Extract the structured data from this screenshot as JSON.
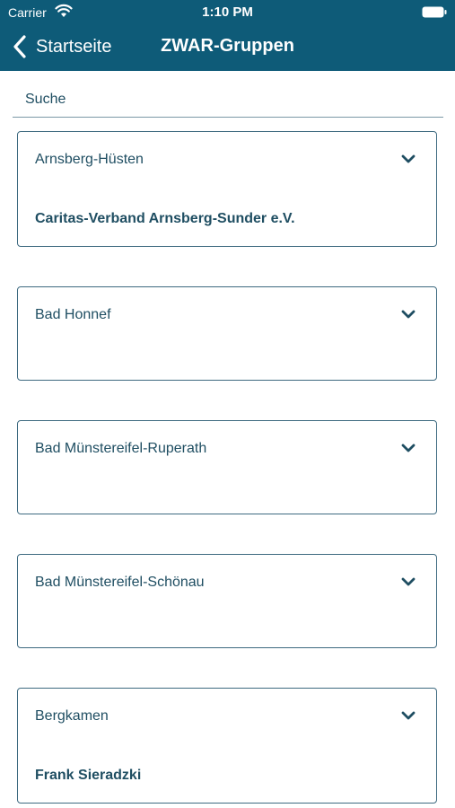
{
  "status_bar": {
    "carrier": "Carrier",
    "time": "1:10 PM"
  },
  "nav": {
    "back_label": "Startseite",
    "title": "ZWAR-Gruppen"
  },
  "search": {
    "placeholder": "Suche"
  },
  "groups": [
    {
      "title": "Arnsberg-Hüsten",
      "subtitle": "Caritas-Verband Arnsberg-Sunder e.V."
    },
    {
      "title": "Bad Honnef",
      "subtitle": ""
    },
    {
      "title": "Bad Münstereifel-Ruperath",
      "subtitle": ""
    },
    {
      "title": "Bad Münstereifel-Schönau",
      "subtitle": ""
    },
    {
      "title": "Bergkamen",
      "subtitle": "Frank Sieradzki"
    }
  ],
  "colors": {
    "header": "#0e5b78",
    "text": "#1f4e62",
    "border": "#3e6a80"
  },
  "icons": [
    "wifi-icon",
    "battery-icon",
    "back-chevron-icon",
    "chevron-down-icon"
  ]
}
